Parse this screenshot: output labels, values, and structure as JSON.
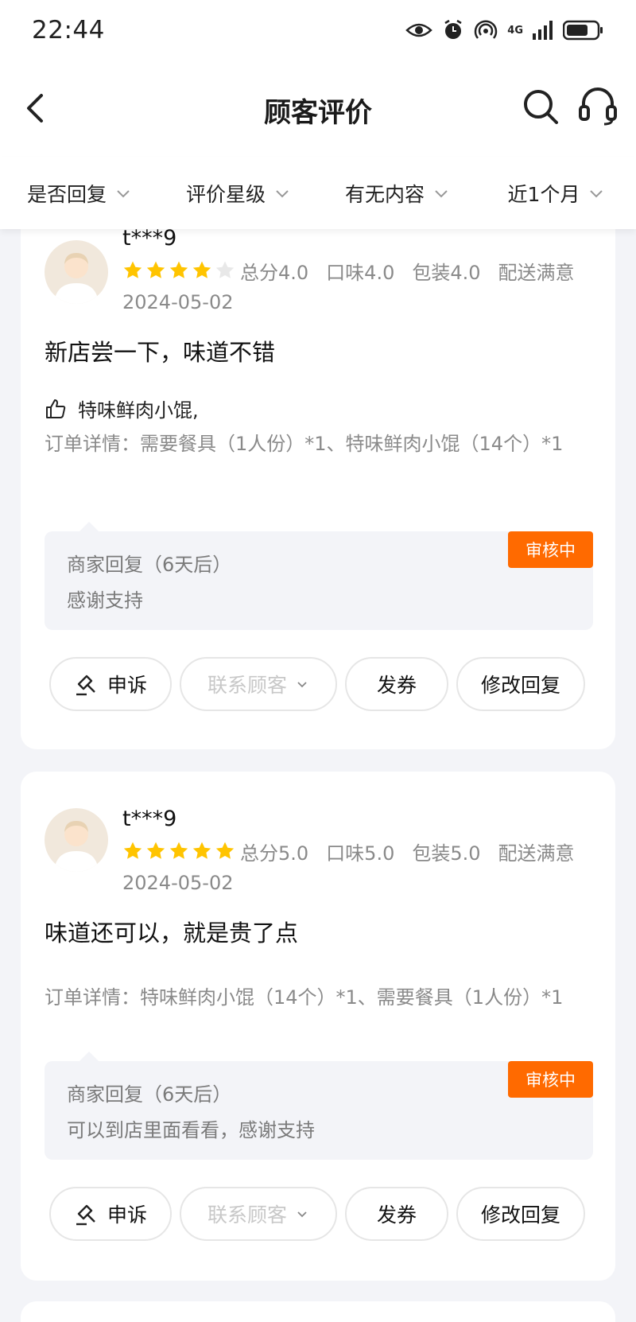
{
  "status_bar": {
    "time": "22:44",
    "network": "4G"
  },
  "nav": {
    "title": "顾客评价"
  },
  "filters": [
    {
      "label": "是否回复"
    },
    {
      "label": "评价星级"
    },
    {
      "label": "有无内容"
    },
    {
      "label": "近1个月"
    }
  ],
  "reviews": [
    {
      "user": "t***9",
      "rating": 4,
      "total": "总分4.0",
      "taste": "口味4.0",
      "package": "包装4.0",
      "delivery": "配送满意",
      "date": "2024-05-02",
      "comment": "新店尝一下，味道不错",
      "liked": "特味鲜肉小馄,",
      "order_detail": "订单详情：需要餐具（1人份）*1、特味鲜肉小馄（14个）*1",
      "reply_title": "商家回复（6天后）",
      "reply_text": "感谢支持",
      "reply_status": "审核中"
    },
    {
      "user": "t***9",
      "rating": 5,
      "total": "总分5.0",
      "taste": "口味5.0",
      "package": "包装5.0",
      "delivery": "配送满意",
      "date": "2024-05-02",
      "comment": "味道还可以，就是贵了点",
      "order_detail": "订单详情：特味鲜肉小馄（14个）*1、需要餐具（1人份）*1",
      "reply_title": "商家回复（6天后）",
      "reply_text": "可以到店里面看看，感谢支持",
      "reply_status": "审核中"
    }
  ],
  "actions": {
    "appeal": "申诉",
    "contact": "联系顾客",
    "coupon": "发券",
    "modify": "修改回复"
  },
  "colors": {
    "accent": "#ff6a00",
    "star": "#ffc400",
    "star_empty": "#e8e8e8"
  }
}
